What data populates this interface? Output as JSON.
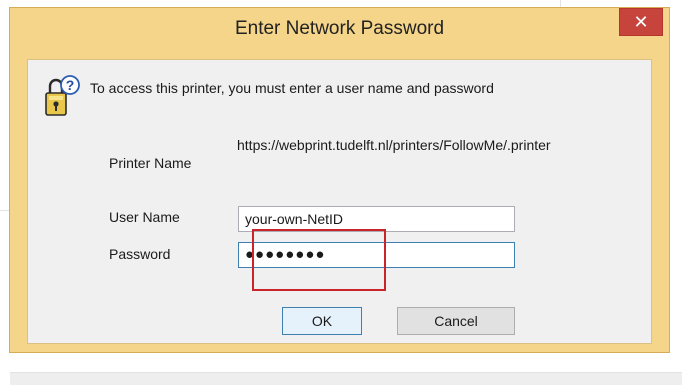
{
  "dialog": {
    "title": "Enter Network Password",
    "close_glyph": "✕",
    "icon": "key-lock-help-icon",
    "message": "To access this printer, you must enter a user name and password",
    "printer_name_label": "Printer Name",
    "printer_name_value": "https://webprint.tudelft.nl/printers/FollowMe/.printer",
    "username_label": "User Name",
    "username_value": "your-own-NetID",
    "password_label": "Password",
    "password_value": "●●●●●●●●",
    "ok_label": "OK",
    "cancel_label": "Cancel"
  },
  "colors": {
    "dialog_frame": "#f5d58a",
    "close_button": "#c7443d",
    "highlight": "#c9232c",
    "client_background": "#f0f0f0"
  }
}
